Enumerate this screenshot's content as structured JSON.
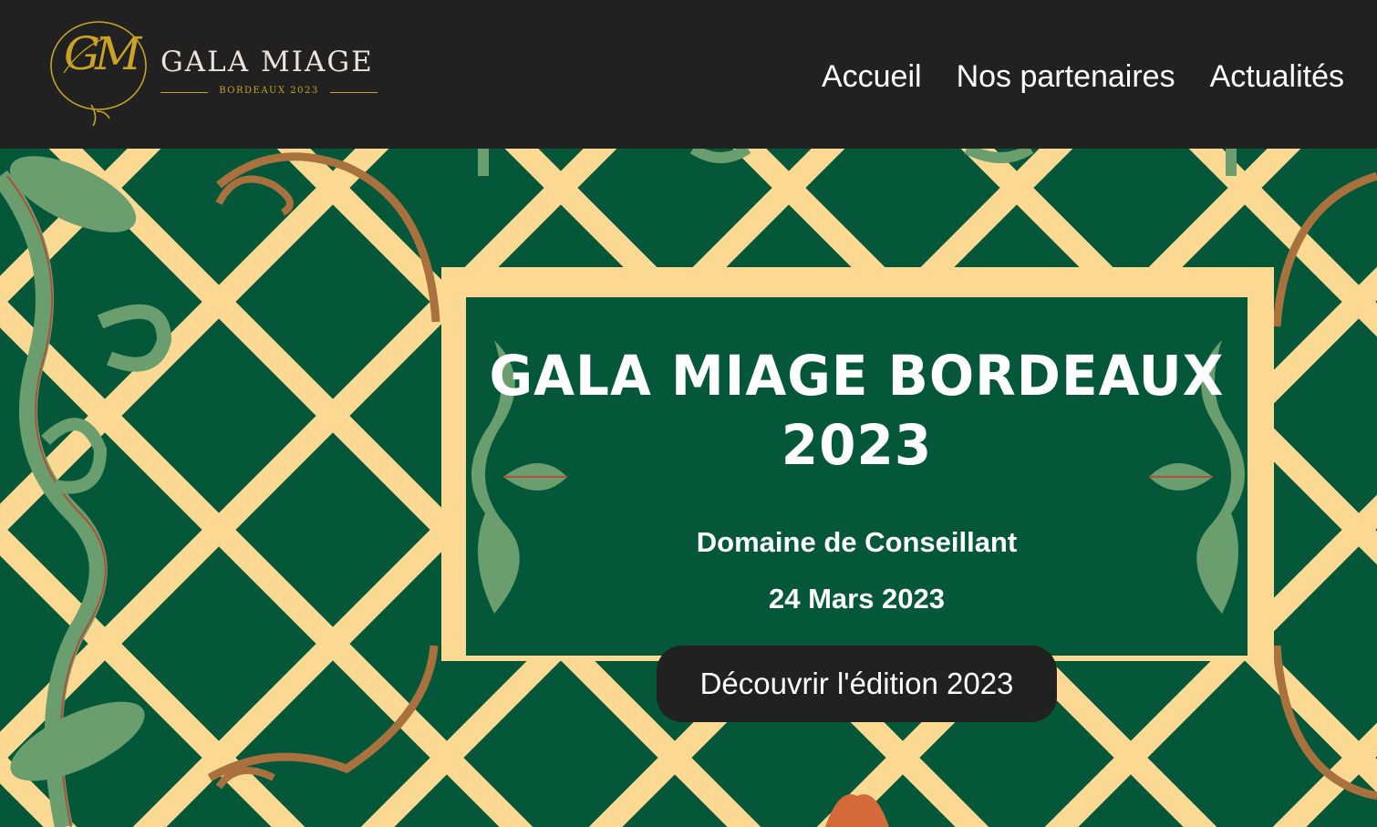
{
  "brand": {
    "monogram": "GM",
    "name": "GALA MIAGE",
    "subtitle": "BORDEAUX 2023",
    "accent_color": "#c9a227"
  },
  "nav": {
    "items": [
      {
        "label": "Accueil"
      },
      {
        "label": "Nos partenaires"
      },
      {
        "label": "Actualités"
      }
    ]
  },
  "hero": {
    "title": "GALA MIAGE BORDEAUX 2023",
    "venue": "Domaine de Conseillant",
    "date": "24 Mars 2023",
    "cta_label": "Découvrir l'édition 2023",
    "colors": {
      "background": "#05573a",
      "lattice": "#fcd993",
      "leaf": "#6a9e6e",
      "vine": "#a8713d",
      "button": "#212121"
    }
  }
}
